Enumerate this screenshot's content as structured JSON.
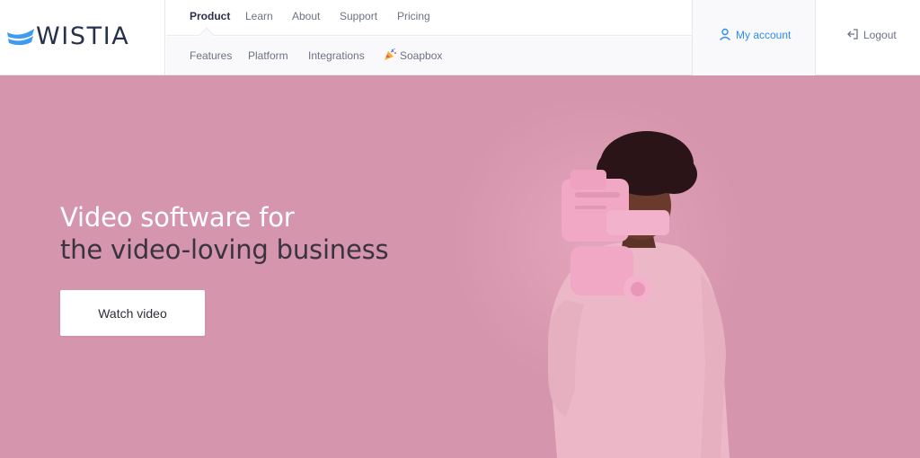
{
  "brand": {
    "name": "WISTIA",
    "logo_icon": "wistia-wave-logo"
  },
  "nav": {
    "primary": [
      {
        "label": "Product",
        "active": true
      },
      {
        "label": "Learn",
        "active": false
      },
      {
        "label": "About",
        "active": false
      },
      {
        "label": "Support",
        "active": false
      },
      {
        "label": "Pricing",
        "active": false
      }
    ],
    "secondary": [
      {
        "label": "Features"
      },
      {
        "label": "Platform"
      },
      {
        "label": "Integrations"
      },
      {
        "label": "Soapbox",
        "icon": "party-popper-icon"
      }
    ]
  },
  "account": {
    "label": "My account",
    "icon": "user-icon"
  },
  "logout": {
    "label": "Logout",
    "icon": "logout-icon"
  },
  "hero": {
    "headline_line1": "Video software for",
    "headline_line2": "the video-loving business",
    "cta_label": "Watch video"
  },
  "colors": {
    "hero_bg": "#d595ac",
    "brand_blue": "#3e9bf0",
    "text_dark": "#28314a",
    "link_blue": "#2c8df0"
  }
}
